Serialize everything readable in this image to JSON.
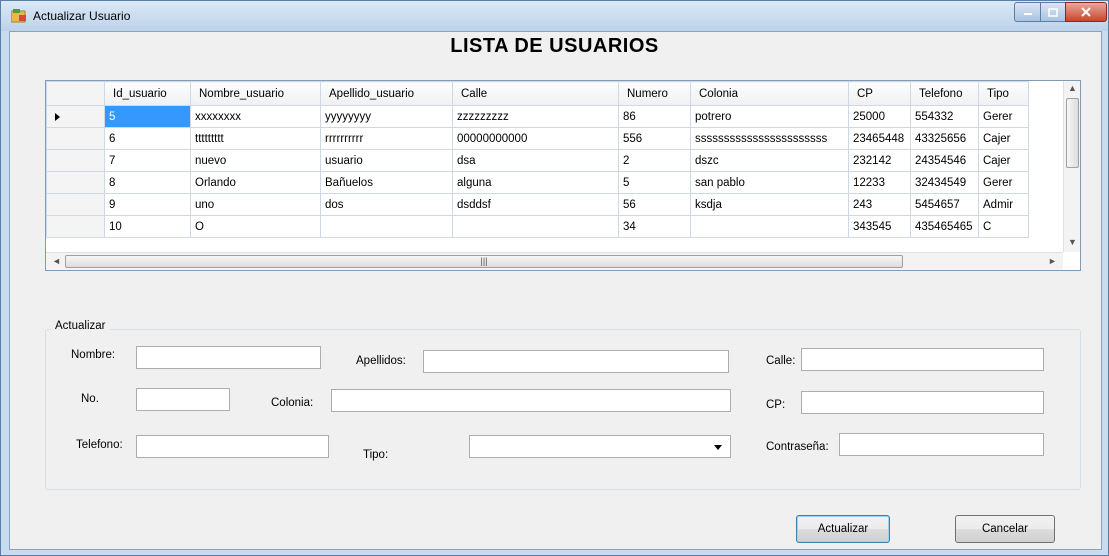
{
  "window": {
    "title": "Actualizar Usuario",
    "buttons": [
      "minimize",
      "maximize",
      "close"
    ]
  },
  "form": {
    "heading": "LISTA DE USUARIOS"
  },
  "grid": {
    "columns": [
      "Id_usuario",
      "Nombre_usuario",
      "Apellido_usuario",
      "Calle",
      "Numero",
      "Colonia",
      "CP",
      "Telefono",
      "Tipo"
    ],
    "rows": [
      [
        "5",
        "xxxxxxxx",
        "yyyyyyyy",
        "zzzzzzzzz",
        "86",
        "potrero",
        "25000",
        "554332",
        "Gerer"
      ],
      [
        "6",
        "ttttttttt",
        "rrrrrrrrrr",
        "00000000000",
        "556",
        "sssssssssssssssssssssss",
        "23465448",
        "43325656",
        "Cajer"
      ],
      [
        "7",
        "nuevo",
        "usuario",
        "dsa",
        "2",
        "dszc",
        "232142",
        "24354546",
        "Cajer"
      ],
      [
        "8",
        "Orlando",
        "Bañuelos",
        "alguna",
        "5",
        "san pablo",
        "12233",
        "32434549",
        "Gerer"
      ],
      [
        "9",
        "uno",
        "dos",
        "dsddsf",
        "56",
        "ksdja",
        "243",
        "5454657",
        "Admir"
      ],
      [
        "10",
        "O",
        "",
        "",
        "34",
        "",
        "343545",
        "435465465",
        "C"
      ]
    ],
    "selected_row": 0
  },
  "group": {
    "label": "Actualizar",
    "labels": {
      "nombre": "Nombre:",
      "apellidos": "Apellidos:",
      "calle": "Calle:",
      "no": "No.",
      "colonia": "Colonia:",
      "cp": "CP:",
      "telefono": "Telefono:",
      "tipo": "Tipo:",
      "contrasena": "Contraseña:"
    },
    "values": {
      "nombre": "",
      "apellidos": "",
      "calle": "",
      "no": "",
      "colonia": "",
      "cp": "",
      "telefono": "",
      "tipo": "",
      "contrasena": ""
    }
  },
  "actions": {
    "update": "Actualizar",
    "cancel": "Cancelar"
  },
  "colors": {
    "selection": "#3399ff",
    "window_frame": "#c9dcef",
    "client": "#f0f0f0"
  }
}
